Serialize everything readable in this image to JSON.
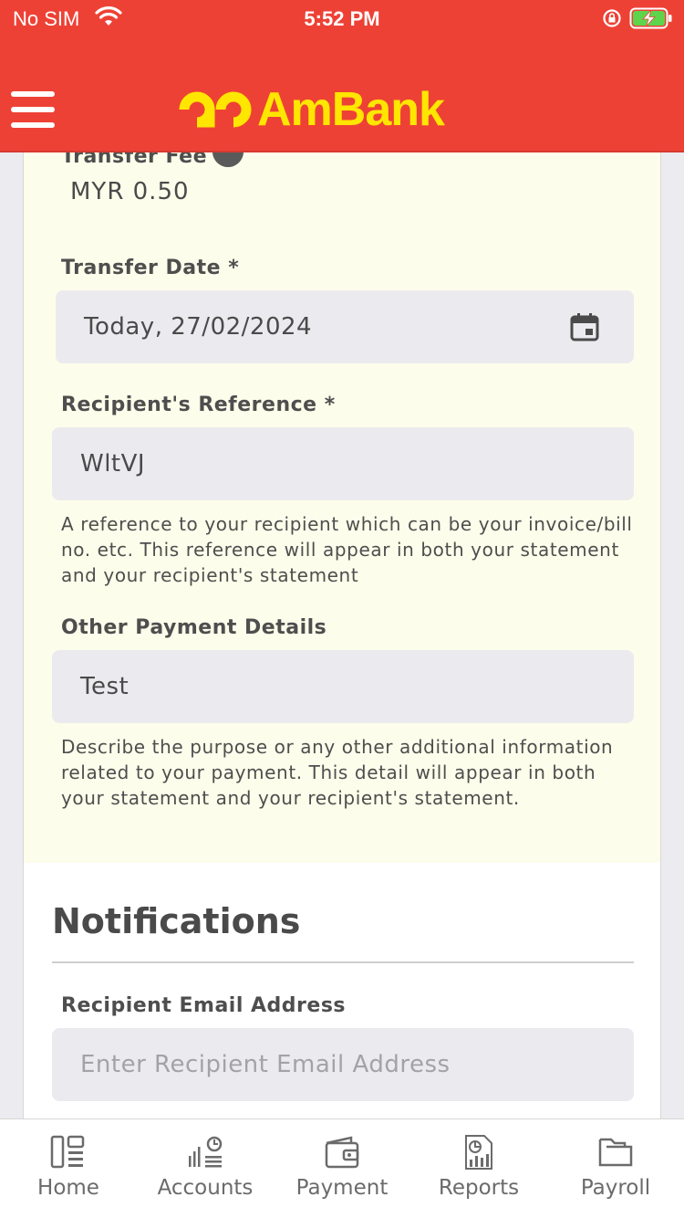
{
  "status_bar": {
    "carrier": "No SIM",
    "time": "5:52 PM"
  },
  "header": {
    "brand": "AmBank",
    "brand_color": "#ffe600",
    "bar_color": "#ee4135"
  },
  "form": {
    "transfer_fee": {
      "label": "Transfer Fee",
      "value": "MYR 0.50"
    },
    "transfer_date": {
      "label": "Transfer Date *",
      "value": "Today, 27/02/2024"
    },
    "recipient_reference": {
      "label": "Recipient's Reference *",
      "value": "WltVJ",
      "helper": "A reference to your recipient which can be your invoice/bill no. etc. This reference will appear in both your statement and your recipient's statement"
    },
    "other_payment_details": {
      "label": "Other Payment Details",
      "value": "Test",
      "helper": "Describe the purpose or any other additional information related to your payment. This detail will appear in both your statement and your recipient's statement."
    }
  },
  "notifications": {
    "title": "Notifications",
    "email_label": "Recipient Email Address",
    "email_placeholder": "Enter Recipient Email Address"
  },
  "tabs": [
    {
      "label": "Home",
      "icon": "home-icon"
    },
    {
      "label": "Accounts",
      "icon": "accounts-icon"
    },
    {
      "label": "Payment",
      "icon": "wallet-icon"
    },
    {
      "label": "Reports",
      "icon": "reports-icon"
    },
    {
      "label": "Payroll",
      "icon": "folder-icon"
    }
  ]
}
